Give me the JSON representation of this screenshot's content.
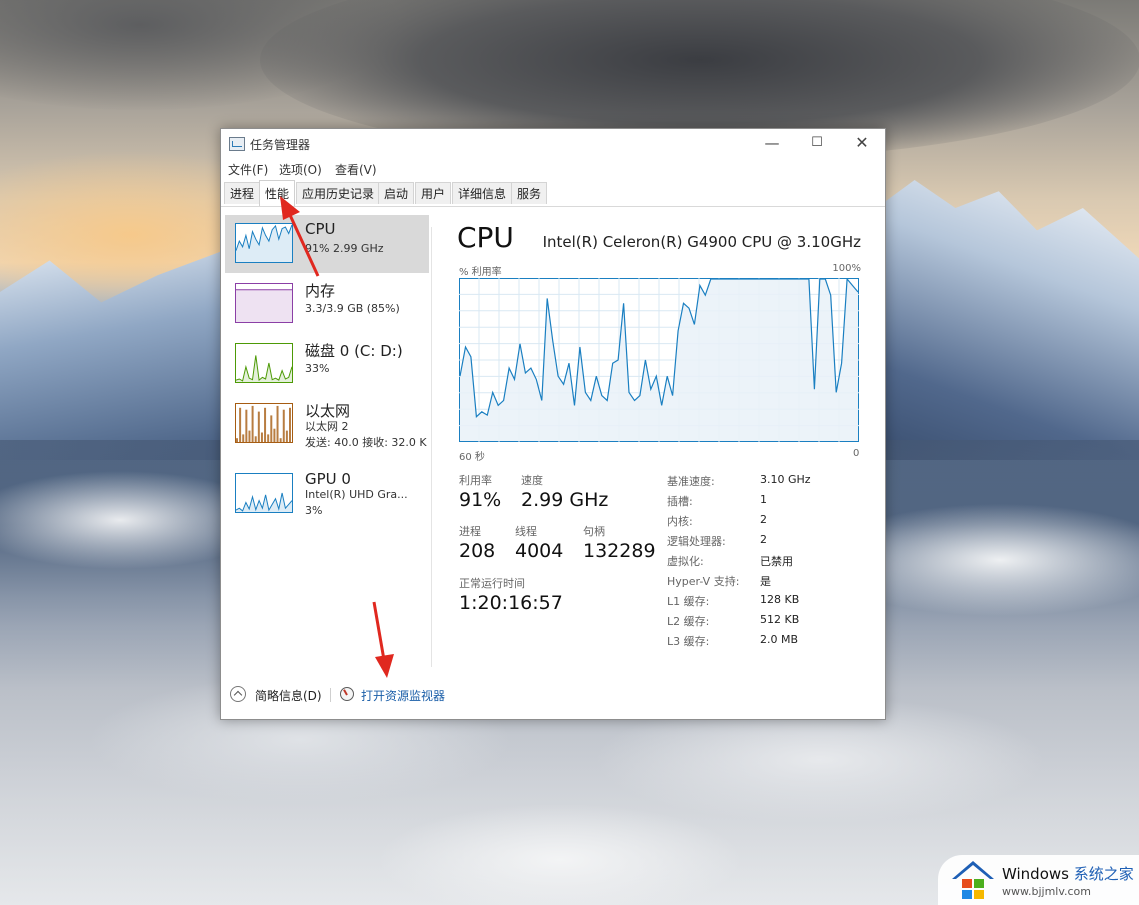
{
  "window": {
    "title": "任务管理器",
    "controls": {
      "minimize": "—",
      "maximize": "☐",
      "close": "✕"
    }
  },
  "menu": [
    "文件(F)",
    "选项(O)",
    "查看(V)"
  ],
  "tabs": [
    {
      "label": "进程",
      "active": false
    },
    {
      "label": "性能",
      "active": true
    },
    {
      "label": "应用历史记录",
      "active": false
    },
    {
      "label": "启动",
      "active": false
    },
    {
      "label": "用户",
      "active": false
    },
    {
      "label": "详细信息",
      "active": false
    },
    {
      "label": "服务",
      "active": false
    }
  ],
  "sidebar": {
    "items": [
      {
        "title": "CPU",
        "subtitle": "91% 2.99 GHz",
        "subtitle2": "",
        "selected": true,
        "color": "#1a7fc1",
        "graph": "cpu"
      },
      {
        "title": "内存",
        "subtitle": "3.3/3.9 GB (85%)",
        "subtitle2": "",
        "selected": false,
        "color": "#8b3fa6",
        "graph": "mem"
      },
      {
        "title": "磁盘 0 (C: D:)",
        "subtitle": "33%",
        "subtitle2": "",
        "selected": false,
        "color": "#4d9a06",
        "graph": "disk"
      },
      {
        "title": "以太网",
        "subtitle": "以太网 2",
        "subtitle2": "发送: 40.0  接收: 32.0 K",
        "selected": false,
        "color": "#a65c12",
        "graph": "net"
      },
      {
        "title": "GPU 0",
        "subtitle": "Intel(R) UHD Gra...",
        "subtitle2": "3%",
        "selected": false,
        "color": "#1a7fc1",
        "graph": "gpu"
      }
    ]
  },
  "main": {
    "title": "CPU",
    "model": "Intel(R) Celeron(R) G4900 CPU @ 3.10GHz",
    "graph_label_left": "% 利用率",
    "graph_label_right": "100%",
    "time_left": "60 秒",
    "time_right": "0",
    "utilization_label": "利用率",
    "utilization_value": "91%",
    "speed_label": "速度",
    "speed_value": "2.99 GHz",
    "processes_label": "进程",
    "processes_value": "208",
    "threads_label": "线程",
    "threads_value": "4004",
    "handles_label": "句柄",
    "handles_value": "132289",
    "uptime_label": "正常运行时间",
    "uptime_value": "1:20:16:57",
    "specs": [
      {
        "label": "基准速度:",
        "value": "3.10 GHz"
      },
      {
        "label": "插槽:",
        "value": "1"
      },
      {
        "label": "内核:",
        "value": "2"
      },
      {
        "label": "逻辑处理器:",
        "value": "2"
      },
      {
        "label": "虚拟化:",
        "value": "已禁用"
      },
      {
        "label": "Hyper-V 支持:",
        "value": "是"
      },
      {
        "label": "L1 缓存:",
        "value": "128 KB"
      },
      {
        "label": "L2 缓存:",
        "value": "512 KB"
      },
      {
        "label": "L3 缓存:",
        "value": "2.0 MB"
      }
    ],
    "cpu_history_percent": [
      40,
      58,
      52,
      15,
      18,
      16,
      30,
      22,
      25,
      45,
      38,
      60,
      42,
      45,
      38,
      25,
      88,
      62,
      40,
      35,
      48,
      22,
      58,
      30,
      25,
      40,
      28,
      25,
      48,
      50,
      85,
      30,
      25,
      28,
      50,
      32,
      40,
      22,
      40,
      28,
      68,
      85,
      82,
      72,
      96,
      90,
      100,
      100,
      100,
      100,
      100,
      100,
      100,
      100,
      100,
      100,
      100,
      100,
      100,
      100,
      100,
      100,
      100,
      100,
      100,
      32,
      100,
      100,
      90,
      30,
      48,
      100,
      96,
      92
    ]
  },
  "footer": {
    "fewer_details": "简略信息(D)",
    "open_monitor": "打开资源监视器"
  },
  "colors": {
    "cpu_line": "#1a7fc1",
    "cpu_fill": "#e9f1f8",
    "arrow": "#e0281f",
    "link": "#1a5ea8"
  },
  "watermark": {
    "brand": "Windows",
    "brand_zh": "系统之家",
    "url": "www.bjjmlv.com"
  }
}
